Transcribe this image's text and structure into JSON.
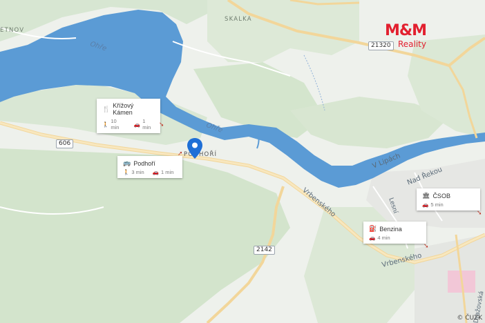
{
  "logo": {
    "brand": "M&M",
    "sub": "Reality"
  },
  "copyright": "© ČUZK",
  "labels": {
    "water": [
      "Ohře",
      "Ohře"
    ],
    "towns": [
      "SKALKA",
      "PODHOŘÍ",
      "ETNOV"
    ],
    "streets": [
      "V Lipách",
      "Nad Řekou",
      "Vrbenského",
      "Vrbenského",
      "Lesní",
      "Dražovská"
    ]
  },
  "road_shields": [
    "606",
    "21320",
    "2142"
  ],
  "pois": [
    {
      "name": "Křížový Kámen",
      "icon": "restaurant-icon",
      "walk": "10 min",
      "car": "1 min"
    },
    {
      "name": "Podhoří",
      "icon": "bus-icon",
      "walk": "3 min",
      "car": "1 min"
    },
    {
      "name": "ČSOB",
      "icon": "bank-icon",
      "car": "5 min"
    },
    {
      "name": "Benzina",
      "icon": "fuel-icon",
      "car": "4 min"
    }
  ],
  "colors": {
    "water": "#5b9bd5",
    "brand": "#e2202f",
    "pin": "#1f6fd6"
  }
}
